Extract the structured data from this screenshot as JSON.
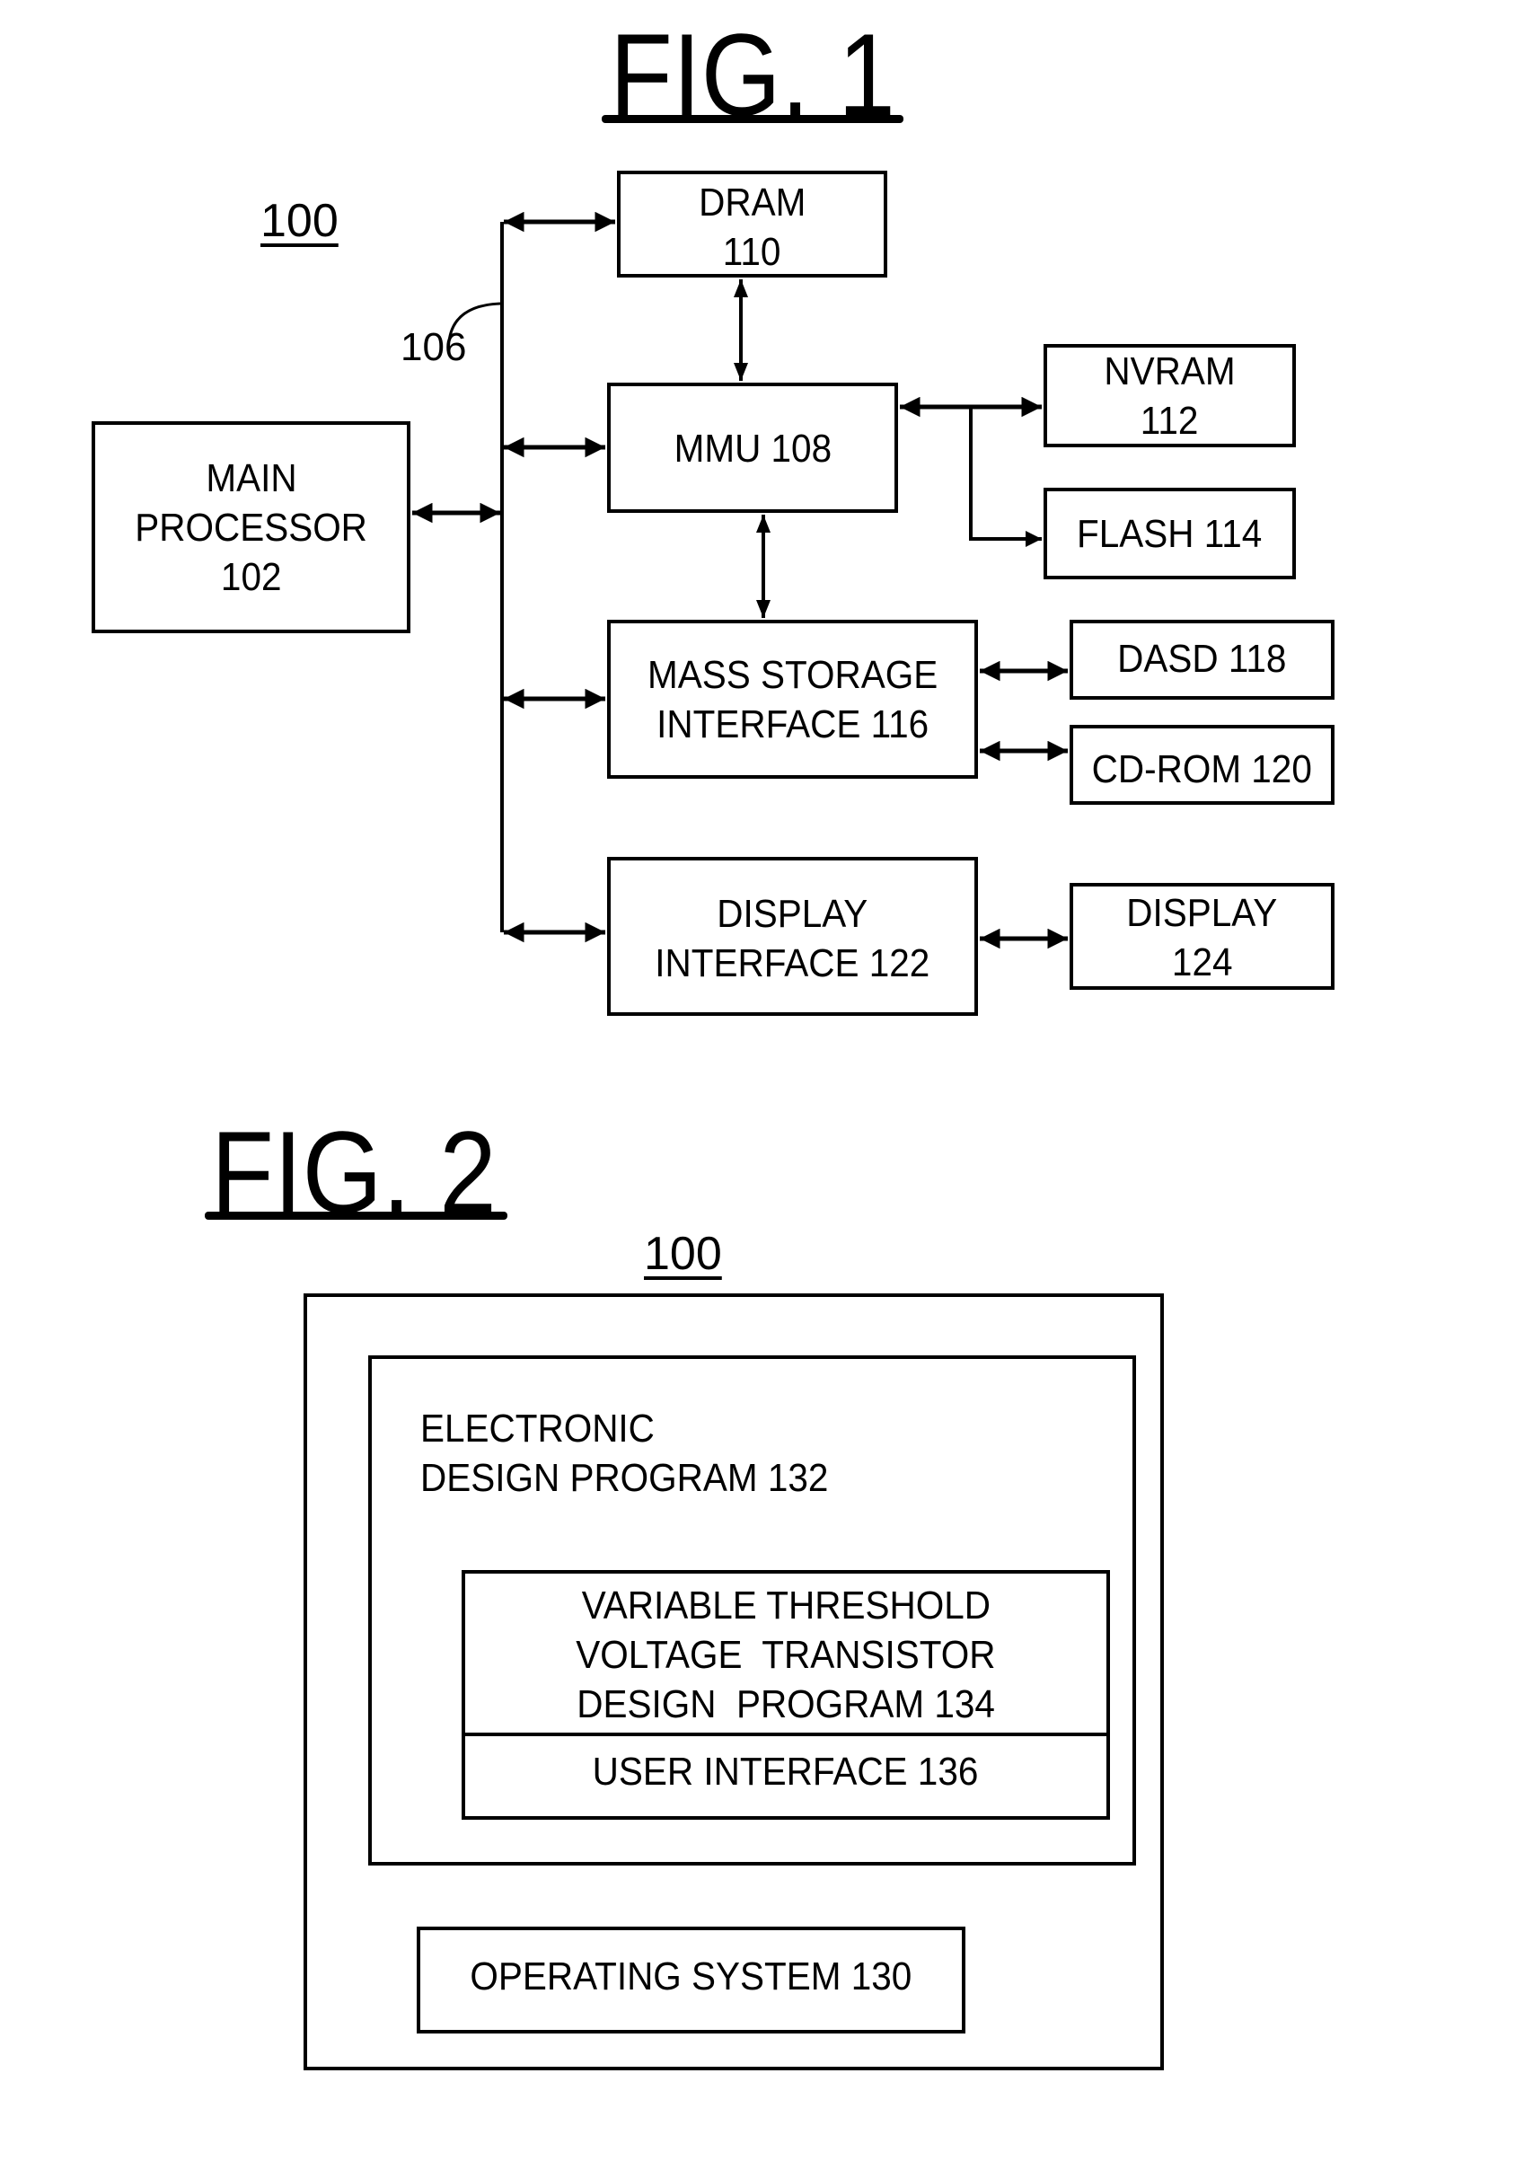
{
  "fig1": {
    "title": "FIG. 1",
    "system_ref": "100",
    "bus_ref": "106",
    "blocks": {
      "main_processor": [
        "MAIN",
        "PROCESSOR",
        "102"
      ],
      "dram": [
        "DRAM",
        "110"
      ],
      "mmu": [
        "MMU 108"
      ],
      "nvram": [
        "NVRAM",
        "112"
      ],
      "flash": [
        "FLASH 114"
      ],
      "mass_storage": [
        "MASS STORAGE",
        "INTERFACE 116"
      ],
      "dasd": [
        "DASD 118"
      ],
      "cdrom": [
        "CD-ROM 120"
      ],
      "display_interface": [
        "DISPLAY",
        "INTERFACE 122"
      ],
      "display": [
        "DISPLAY",
        "124"
      ]
    }
  },
  "fig2": {
    "title": "FIG. 2",
    "system_ref": "100",
    "blocks": {
      "electronic_design_program": [
        "ELECTRONIC",
        "DESIGN PROGRAM 132"
      ],
      "vtv_program": [
        "VARIABLE THRESHOLD",
        "VOLTAGE  TRANSISTOR",
        "DESIGN  PROGRAM 134"
      ],
      "user_interface": [
        "USER INTERFACE 136"
      ],
      "operating_system": [
        "OPERATING SYSTEM 130"
      ]
    }
  }
}
